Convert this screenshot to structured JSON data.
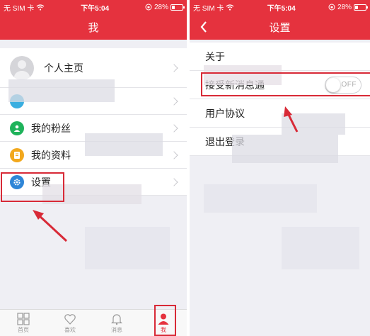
{
  "status": {
    "carrier": "无 SIM 卡",
    "time": "下午5:04",
    "battery": "28%",
    "battery_level": 0.28
  },
  "left": {
    "title": "我",
    "items": [
      {
        "label": "个人主页"
      },
      {
        "label": ""
      },
      {
        "label": "我的粉丝"
      },
      {
        "label": "我的资料"
      },
      {
        "label": "设置"
      }
    ],
    "tabs": [
      {
        "label": "首页",
        "icon": "grid-icon"
      },
      {
        "label": "喜欢",
        "icon": "heart-icon"
      },
      {
        "label": "消息",
        "icon": "bell-icon"
      },
      {
        "label": "我",
        "icon": "person-icon"
      }
    ]
  },
  "right": {
    "title": "设置",
    "items": [
      {
        "label": "关于"
      },
      {
        "label": "接受新消息通"
      },
      {
        "label": "用户协议"
      },
      {
        "label": "退出登录"
      }
    ],
    "toggle": "OFF"
  },
  "colors": {
    "brand": "#e5323e",
    "highlight": "#d82a37",
    "fans_icon": "#1fb35b",
    "profile_icon": "#f2a81d",
    "settings_icon": "#2f86d7"
  }
}
